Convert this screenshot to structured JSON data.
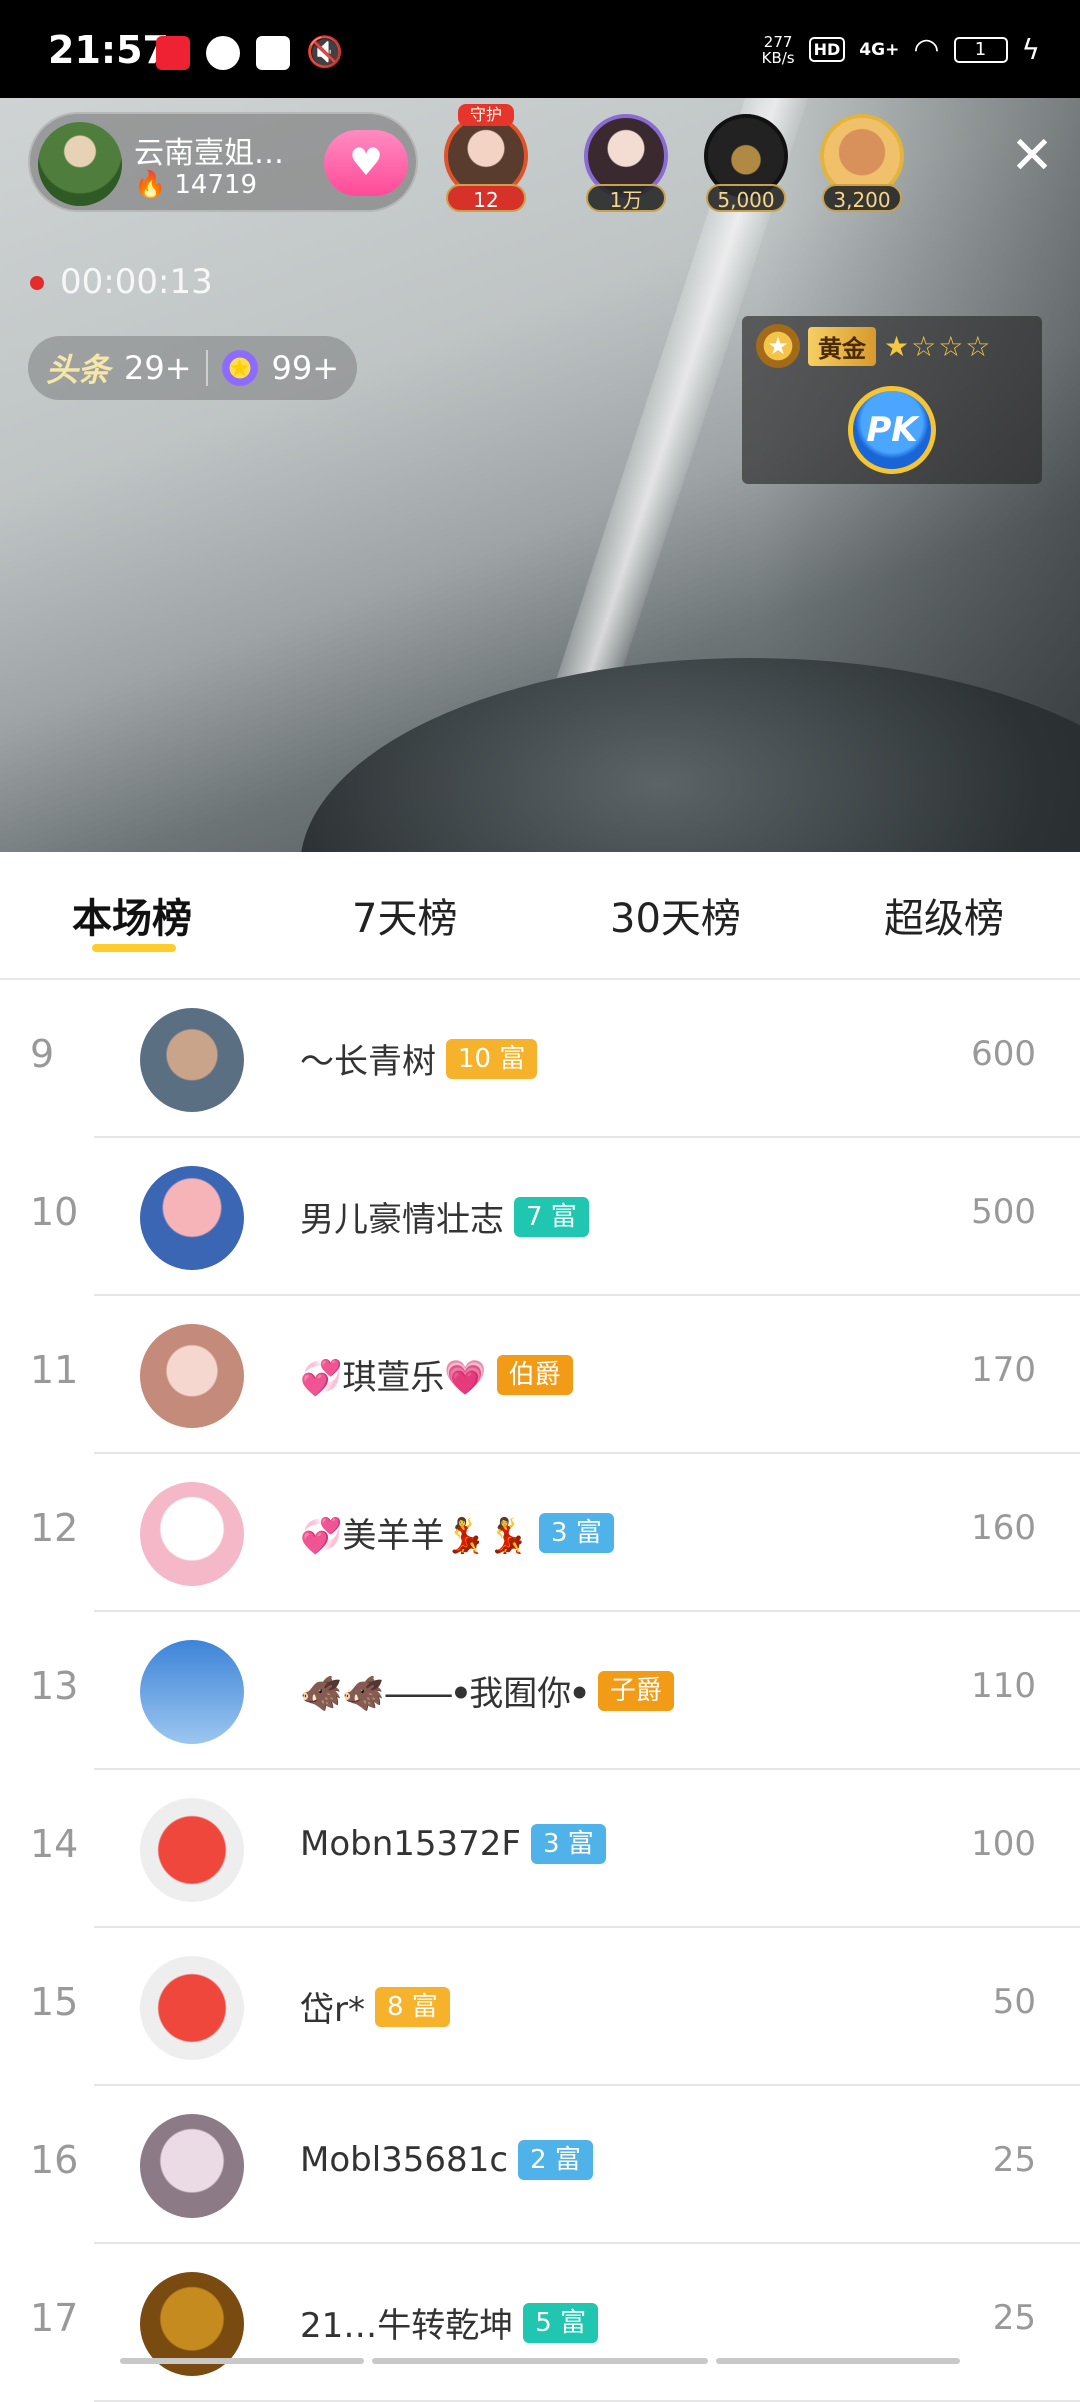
{
  "status_bar": {
    "time": "21:57",
    "net_speed_value": "277",
    "net_speed_unit": "KB/s",
    "hd": "HD",
    "signal": "4G+",
    "battery": "1"
  },
  "live": {
    "host_name": "云南壹姐…",
    "host_fans": "14719",
    "follow_icon": "heart-icon",
    "viewers": [
      {
        "badge": "12",
        "crown": "守护"
      },
      {
        "badge": "1万"
      },
      {
        "badge": "5,000"
      },
      {
        "badge": "3,200"
      }
    ],
    "record_time": "00:00:13",
    "stat_toutiao_label": "头条",
    "stat_toutiao_value": "29+",
    "stat_star_value": "99+",
    "pk_tier": "黄金",
    "pk_stars": "★☆☆☆",
    "pk_button": "PK"
  },
  "tabs": [
    "本场榜",
    "7天榜",
    "30天榜",
    "超级榜"
  ],
  "active_tab": 0,
  "colors": {
    "accent": "#ffcd2a",
    "level_orange": "#f6b22b",
    "level_teal": "#20c6b0",
    "level_blue": "#4fb3ea",
    "noble_gold": "#f29b16"
  },
  "rankings": [
    {
      "rank": "9",
      "name": "～长青树",
      "level": "10 富",
      "level_color": "#f6b22b",
      "score": "600"
    },
    {
      "rank": "10",
      "name": "男儿豪情壮志",
      "level": "7 富",
      "level_color": "#20c6b0",
      "score": "500"
    },
    {
      "rank": "11",
      "name": "💞琪萱乐💗",
      "level": "伯爵",
      "level_color": "#f29b16",
      "score": "170"
    },
    {
      "rank": "12",
      "name": "💞美羊羊💃💃",
      "level": "3 富",
      "level_color": "#4fb3ea",
      "score": "160"
    },
    {
      "rank": "13",
      "name": "🐗🐗⸺ꔷ我囿你ꔷ",
      "level": "子爵",
      "level_color": "#f29b16",
      "score": "110"
    },
    {
      "rank": "14",
      "name": "Mobn15372F",
      "level": "3 富",
      "level_color": "#4fb3ea",
      "score": "100"
    },
    {
      "rank": "15",
      "name": "岱r*",
      "level": "8 富",
      "level_color": "#f6b22b",
      "score": "50"
    },
    {
      "rank": "16",
      "name": "Mobl35681c",
      "level": "2 富",
      "level_color": "#4fb3ea",
      "score": "25"
    },
    {
      "rank": "17",
      "name": "21…牛转乾坤",
      "level": "5 富",
      "level_color": "#20c6b0",
      "score": "25"
    }
  ]
}
